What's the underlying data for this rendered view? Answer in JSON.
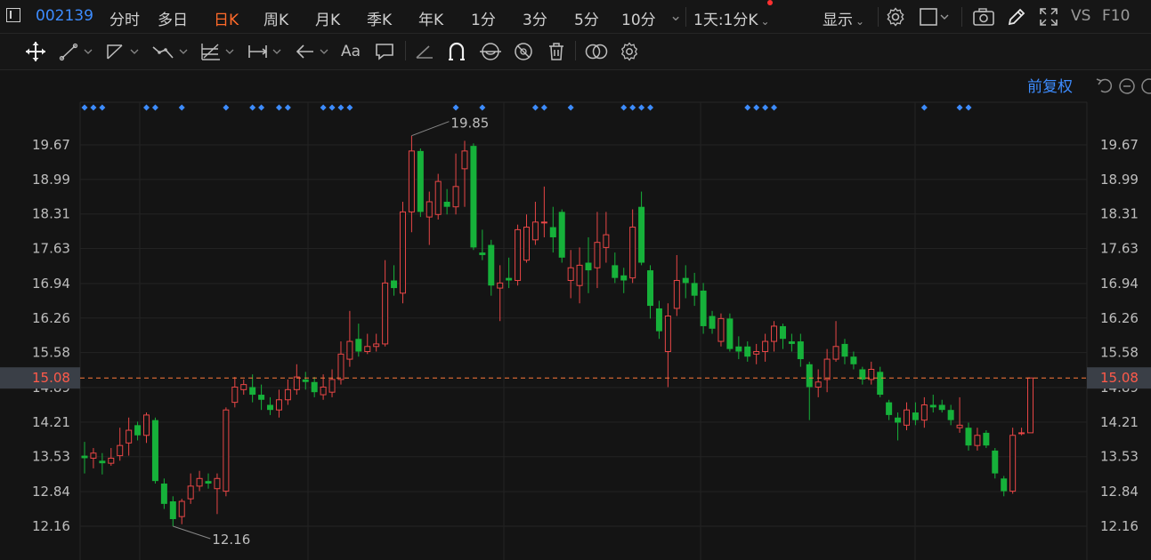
{
  "topbar": {
    "stock_code": "002139",
    "periods": [
      "分时",
      "多日",
      "日K",
      "周K",
      "月K",
      "季K",
      "年K",
      "1分",
      "3分",
      "5分",
      "10分"
    ],
    "active_period": "日K",
    "more_periods_label": "1天:1分K",
    "display_label": "显示",
    "vs_label": "VS",
    "f10_label": "F10"
  },
  "toolbar": {
    "text_tool_label": "Aa"
  },
  "chart_panel": {
    "adjust_label": "前复权",
    "current_price_label": "15.08",
    "high_label": "19.85",
    "low_label": "12.16"
  },
  "colors": {
    "up": "#e84646",
    "down": "#16b13a",
    "accent": "#ff6a2a",
    "blue": "#3d8cff",
    "dashed": "#ff7a3a"
  },
  "chart_data": {
    "type": "candlestick",
    "y_ticks": [
      19.67,
      18.99,
      18.31,
      17.63,
      16.94,
      16.26,
      15.58,
      14.89,
      14.21,
      13.53,
      12.84,
      12.16
    ],
    "ylim": [
      12.0,
      20.2
    ],
    "current_price": 15.08,
    "high": 19.85,
    "low": 12.16,
    "event_markers": [
      1,
      2,
      3,
      8,
      9,
      12,
      17,
      20,
      21,
      23,
      24,
      28,
      29,
      30,
      31,
      43,
      46,
      52,
      53,
      56,
      62,
      63,
      64,
      65,
      76,
      77,
      78,
      79,
      96,
      100,
      101
    ],
    "candles": [
      [
        13.55,
        13.5,
        13.82,
        13.2
      ],
      [
        13.5,
        13.6,
        13.7,
        13.3
      ],
      [
        13.45,
        13.4,
        13.6,
        13.18
      ],
      [
        13.4,
        13.5,
        13.7,
        13.35
      ],
      [
        13.55,
        13.75,
        14.1,
        13.45
      ],
      [
        13.8,
        14.05,
        14.3,
        13.55
      ],
      [
        14.15,
        13.95,
        14.22,
        13.85
      ],
      [
        13.95,
        14.35,
        14.4,
        13.8
      ],
      [
        14.25,
        13.05,
        14.3,
        13.0
      ],
      [
        13.0,
        12.6,
        13.1,
        12.5
      ],
      [
        12.65,
        12.3,
        12.75,
        12.16
      ],
      [
        12.35,
        12.65,
        12.7,
        12.2
      ],
      [
        12.7,
        12.95,
        13.2,
        12.6
      ],
      [
        12.95,
        13.1,
        13.25,
        12.85
      ],
      [
        13.05,
        13.0,
        13.2,
        12.9
      ],
      [
        12.9,
        13.1,
        13.2,
        12.4
      ],
      [
        12.85,
        14.45,
        14.5,
        12.75
      ],
      [
        14.6,
        14.9,
        15.1,
        14.5
      ],
      [
        14.85,
        14.95,
        15.05,
        14.75
      ],
      [
        14.9,
        14.75,
        15.15,
        14.6
      ],
      [
        14.75,
        14.65,
        14.95,
        14.45
      ],
      [
        14.55,
        14.45,
        14.7,
        14.35
      ],
      [
        14.45,
        14.65,
        14.85,
        14.3
      ],
      [
        14.65,
        14.85,
        15.05,
        14.55
      ],
      [
        14.85,
        15.1,
        15.35,
        14.75
      ],
      [
        15.05,
        15.0,
        15.2,
        14.85
      ],
      [
        15.0,
        14.8,
        15.1,
        14.7
      ],
      [
        14.75,
        14.9,
        15.15,
        14.65
      ],
      [
        14.8,
        15.05,
        15.25,
        14.7
      ],
      [
        15.05,
        15.55,
        15.8,
        14.95
      ],
      [
        15.45,
        15.8,
        16.4,
        15.3
      ],
      [
        15.85,
        15.6,
        16.15,
        15.5
      ],
      [
        15.6,
        15.7,
        15.95,
        15.55
      ],
      [
        15.7,
        15.75,
        15.95,
        15.6
      ],
      [
        15.75,
        16.95,
        17.4,
        15.7
      ],
      [
        17.0,
        16.85,
        17.3,
        16.7
      ],
      [
        16.75,
        18.35,
        18.55,
        16.55
      ],
      [
        18.35,
        19.55,
        19.85,
        17.95
      ],
      [
        19.55,
        18.35,
        19.6,
        18.25
      ],
      [
        18.25,
        18.55,
        18.75,
        17.7
      ],
      [
        18.3,
        18.95,
        19.1,
        18.2
      ],
      [
        18.55,
        18.45,
        18.8,
        18.3
      ],
      [
        18.45,
        18.85,
        19.5,
        18.3
      ],
      [
        19.2,
        19.55,
        19.75,
        18.45
      ],
      [
        19.65,
        17.65,
        19.7,
        17.6
      ],
      [
        17.55,
        17.5,
        18.0,
        17.4
      ],
      [
        17.7,
        16.9,
        17.8,
        16.7
      ],
      [
        16.85,
        16.95,
        17.3,
        16.2
      ],
      [
        17.05,
        17.0,
        17.45,
        16.85
      ],
      [
        17.0,
        18.0,
        18.1,
        16.9
      ],
      [
        17.4,
        18.05,
        18.3,
        17.35
      ],
      [
        17.8,
        18.15,
        18.55,
        17.7
      ],
      [
        18.15,
        18.15,
        18.85,
        17.85
      ],
      [
        18.05,
        17.85,
        18.45,
        17.55
      ],
      [
        18.35,
        17.45,
        18.4,
        17.35
      ],
      [
        17.0,
        17.25,
        17.6,
        16.65
      ],
      [
        16.9,
        17.3,
        17.65,
        16.55
      ],
      [
        17.35,
        17.2,
        17.85,
        16.75
      ],
      [
        17.25,
        17.75,
        18.35,
        16.85
      ],
      [
        17.65,
        17.9,
        18.35,
        17.35
      ],
      [
        17.3,
        17.05,
        17.55,
        16.95
      ],
      [
        17.1,
        17.0,
        17.25,
        16.75
      ],
      [
        17.05,
        18.05,
        18.4,
        16.95
      ],
      [
        18.45,
        17.35,
        18.75,
        17.3
      ],
      [
        17.2,
        16.5,
        17.3,
        16.25
      ],
      [
        16.45,
        16.0,
        16.6,
        15.85
      ],
      [
        15.6,
        16.3,
        16.55,
        14.9
      ],
      [
        16.45,
        17.0,
        17.5,
        16.3
      ],
      [
        17.05,
        16.95,
        17.3,
        16.65
      ],
      [
        16.95,
        16.7,
        17.15,
        16.5
      ],
      [
        16.8,
        16.1,
        16.95,
        15.95
      ],
      [
        16.3,
        16.05,
        16.4,
        15.95
      ],
      [
        15.8,
        16.25,
        16.35,
        15.7
      ],
      [
        16.25,
        15.65,
        16.35,
        15.6
      ],
      [
        15.7,
        15.6,
        15.9,
        15.45
      ],
      [
        15.7,
        15.5,
        15.8,
        15.4
      ],
      [
        15.55,
        15.6,
        15.75,
        15.35
      ],
      [
        15.6,
        15.8,
        15.95,
        15.4
      ],
      [
        15.8,
        16.1,
        16.2,
        15.6
      ],
      [
        16.1,
        15.85,
        16.15,
        15.65
      ],
      [
        15.8,
        15.75,
        15.95,
        15.6
      ],
      [
        15.8,
        15.45,
        15.95,
        15.3
      ],
      [
        15.35,
        14.9,
        15.4,
        14.25
      ],
      [
        14.9,
        15.0,
        15.25,
        14.7
      ],
      [
        15.05,
        15.45,
        15.65,
        14.8
      ],
      [
        15.45,
        15.7,
        16.2,
        15.4
      ],
      [
        15.75,
        15.5,
        15.85,
        15.35
      ],
      [
        15.5,
        15.35,
        15.6,
        15.25
      ],
      [
        15.25,
        15.05,
        15.3,
        14.95
      ],
      [
        15.05,
        15.25,
        15.4,
        14.95
      ],
      [
        15.2,
        14.75,
        15.3,
        14.7
      ],
      [
        14.6,
        14.35,
        14.65,
        14.25
      ],
      [
        14.3,
        14.2,
        14.4,
        13.85
      ],
      [
        14.15,
        14.45,
        14.6,
        14.05
      ],
      [
        14.4,
        14.25,
        14.6,
        14.15
      ],
      [
        14.25,
        14.55,
        14.7,
        14.1
      ],
      [
        14.55,
        14.5,
        14.75,
        14.4
      ],
      [
        14.55,
        14.45,
        14.65,
        14.4
      ],
      [
        14.45,
        14.25,
        14.55,
        14.15
      ],
      [
        14.1,
        14.15,
        14.7,
        14.0
      ],
      [
        14.1,
        13.75,
        14.2,
        13.65
      ],
      [
        13.75,
        13.95,
        14.1,
        13.65
      ],
      [
        14.0,
        13.75,
        14.05,
        13.7
      ],
      [
        13.65,
        13.2,
        13.7,
        13.1
      ],
      [
        13.1,
        12.85,
        13.15,
        12.75
      ],
      [
        12.85,
        13.95,
        14.1,
        12.8
      ],
      [
        14.0,
        14.0,
        14.1,
        13.95
      ],
      [
        14.0,
        15.08,
        15.08,
        14.0
      ]
    ]
  }
}
